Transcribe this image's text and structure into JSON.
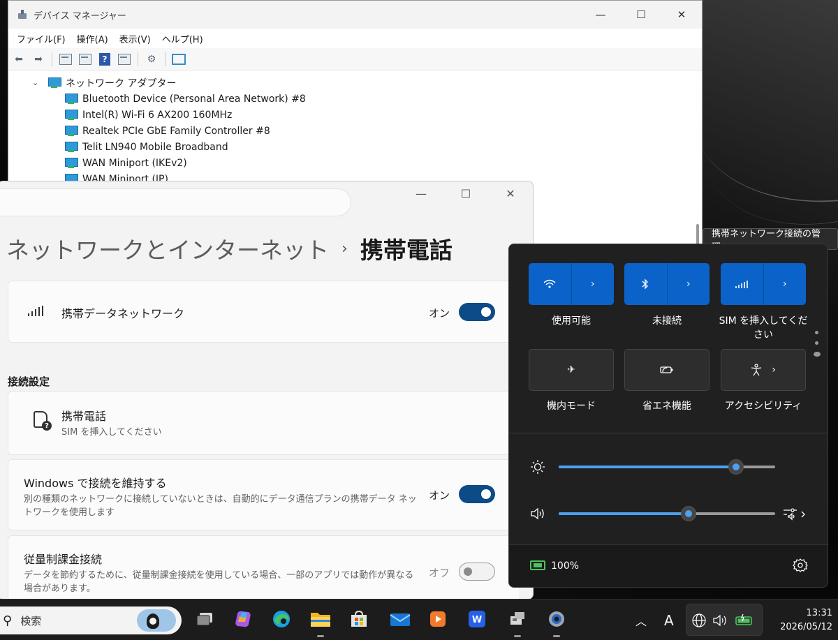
{
  "device_manager": {
    "title": "デバイス マネージャー",
    "menu": [
      "ファイル(F)",
      "操作(A)",
      "表示(V)",
      "ヘルプ(H)"
    ],
    "category": "ネットワーク アダプター",
    "items": [
      "Bluetooth Device (Personal Area Network) #8",
      "Intel(R) Wi-Fi 6 AX200 160MHz",
      "Realtek PCIe GbE Family Controller #8",
      "Telit LN940 Mobile Broadband",
      "WAN Miniport (IKEv2)",
      "WAN Miniport (IP)"
    ]
  },
  "settings": {
    "breadcrumb_parent": "ネットワークとインターネット",
    "breadcrumb_sep": "›",
    "page_title": "携帯電話",
    "cellular_data": {
      "label": "携帯データネットワーク",
      "state": "オン",
      "on": true
    },
    "section_title": "接続設定",
    "cellular": {
      "label": "携帯電話",
      "sub": "SIM を挿入してください"
    },
    "keep_connected": {
      "label": "Windows で接続を維持する",
      "sub": "別の種類のネットワークに接続していないときは、自動的にデータ通信プランの携帯データ ネットワークを使用します",
      "state": "オン",
      "on": true
    },
    "metered": {
      "label": "従量制課金接続",
      "sub": "データを節約するために、従量制課金接続を使用している場合、一部のアプリでは動作が異なる場合があります。",
      "state": "オフ",
      "on": false
    }
  },
  "tooltip": "携帯ネットワーク接続の管理",
  "quick_settings": {
    "tiles": [
      {
        "label": "使用可能",
        "icon": "wifi-icon",
        "on": true
      },
      {
        "label": "未接続",
        "icon": "bluetooth-icon",
        "on": true
      },
      {
        "label": "SIM を挿入してください",
        "icon": "cellular-icon",
        "on": true
      },
      {
        "label": "機内モード",
        "icon": "airplane-icon",
        "on": false
      },
      {
        "label": "省エネ機能",
        "icon": "battery-saver-icon",
        "on": false
      },
      {
        "label": "アクセシビリティ",
        "icon": "accessibility-icon",
        "on": false
      }
    ],
    "brightness_level": 0.82,
    "volume_level": 0.6,
    "battery": "100%"
  },
  "taskbar": {
    "search_placeholder": "検索",
    "time": "13:31",
    "date": "2026/05/12",
    "ime": "A"
  },
  "colors": {
    "accent": "#0b63c9",
    "toggle_on": "#0c4b86",
    "battery_green": "#4cc45c"
  }
}
